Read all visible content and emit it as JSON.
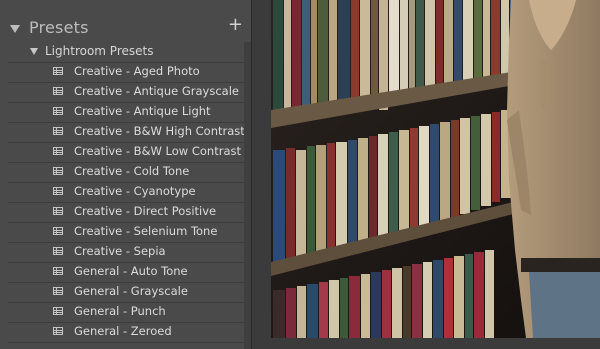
{
  "panel": {
    "title": "Presets",
    "add_symbol": "+",
    "folder_label": "Lightroom Presets",
    "presets": [
      "Creative - Aged Photo",
      "Creative - Antique Grayscale",
      "Creative - Antique Light",
      "Creative - B&W High Contrast",
      "Creative - B&W Low Contrast",
      "Creative - Cold Tone",
      "Creative - Cyanotype",
      "Creative - Direct Positive",
      "Creative - Selenium Tone",
      "Creative - Sepia",
      "General - Auto Tone",
      "General - Grayscale",
      "General - Punch",
      "General - Zeroed"
    ]
  }
}
